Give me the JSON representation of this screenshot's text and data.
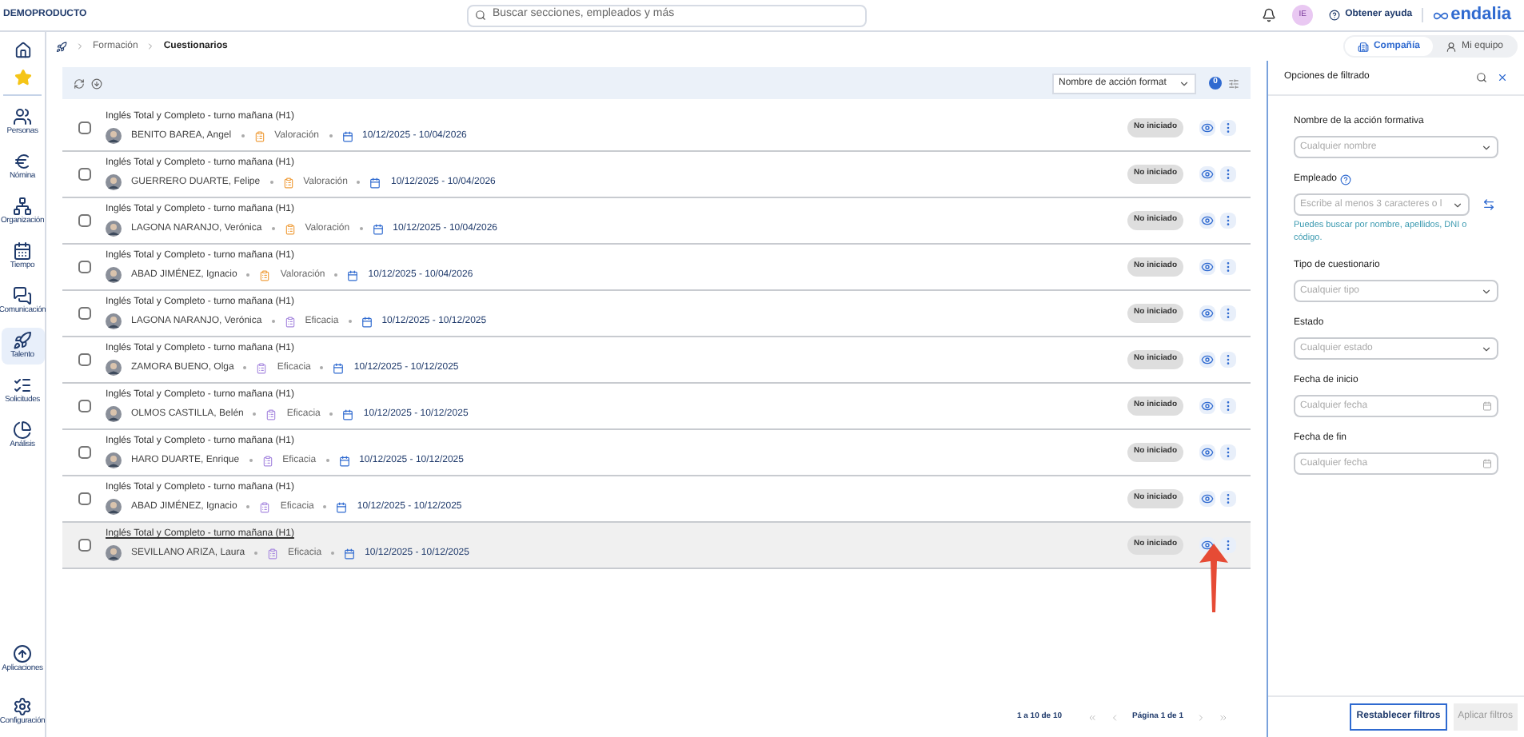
{
  "topbar": {
    "brand": "DEMOPRODUCTO",
    "search": {
      "placeholder": "Buscar secciones, empleados y más"
    },
    "avatar": "IE",
    "help": "Obtener ayuda",
    "logo": "endalia"
  },
  "sidebar": {
    "items": [
      {
        "label": "Personas",
        "selected": false
      },
      {
        "label": "Nómina",
        "selected": false
      },
      {
        "label": "Organización",
        "selected": false
      },
      {
        "label": "Tiempo",
        "selected": false
      },
      {
        "label": "Comunicación",
        "selected": false
      },
      {
        "label": "Talento",
        "selected": true
      },
      {
        "label": "Solicitudes",
        "selected": false
      },
      {
        "label": "Análisis",
        "selected": false
      }
    ],
    "bottom": [
      {
        "label": "Aplicaciones"
      },
      {
        "label": "Configuración"
      }
    ]
  },
  "breadcrumb": [
    "Formación",
    "Cuestionarios"
  ],
  "scope_tabs": [
    {
      "label": "Compañía",
      "selected": true
    },
    {
      "label": "Mi equipo",
      "selected": false
    }
  ],
  "toolbar": {
    "sort": "Nombre de acción format",
    "filter_count": "0"
  },
  "rows": [
    {
      "title": "Inglés Total y Completo - turno mañana (H1)",
      "employee": "BENITO BAREA, Angel",
      "kind": "valoracion",
      "type": "Valoración",
      "dates": "10/12/2025 - 10/04/2026",
      "status": "No iniciado",
      "hovered": false
    },
    {
      "title": "Inglés Total y Completo - turno mañana (H1)",
      "employee": "GUERRERO DUARTE, Felipe",
      "kind": "valoracion",
      "type": "Valoración",
      "dates": "10/12/2025 - 10/04/2026",
      "status": "No iniciado",
      "hovered": false
    },
    {
      "title": "Inglés Total y Completo - turno mañana (H1)",
      "employee": "LAGONA NARANJO, Verónica",
      "kind": "valoracion",
      "type": "Valoración",
      "dates": "10/12/2025 - 10/04/2026",
      "status": "No iniciado",
      "hovered": false
    },
    {
      "title": "Inglés Total y Completo - turno mañana (H1)",
      "employee": "ABAD JIMÉNEZ, Ignacio",
      "kind": "valoracion",
      "type": "Valoración",
      "dates": "10/12/2025 - 10/04/2026",
      "status": "No iniciado",
      "hovered": false
    },
    {
      "title": "Inglés Total y Completo - turno mañana (H1)",
      "employee": "LAGONA NARANJO, Verónica",
      "kind": "eficacia",
      "type": "Eficacia",
      "dates": "10/12/2025 - 10/12/2025",
      "status": "No iniciado",
      "hovered": false
    },
    {
      "title": "Inglés Total y Completo - turno mañana (H1)",
      "employee": "ZAMORA BUENO, Olga",
      "kind": "eficacia",
      "type": "Eficacia",
      "dates": "10/12/2025 - 10/12/2025",
      "status": "No iniciado",
      "hovered": false
    },
    {
      "title": "Inglés Total y Completo - turno mañana (H1)",
      "employee": "OLMOS CASTILLA, Belén",
      "kind": "eficacia",
      "type": "Eficacia",
      "dates": "10/12/2025 - 10/12/2025",
      "status": "No iniciado",
      "hovered": false
    },
    {
      "title": "Inglés Total y Completo - turno mañana (H1)",
      "employee": "HARO DUARTE, Enrique",
      "kind": "eficacia",
      "type": "Eficacia",
      "dates": "10/12/2025 - 10/12/2025",
      "status": "No iniciado",
      "hovered": false
    },
    {
      "title": "Inglés Total y Completo - turno mañana (H1)",
      "employee": "ABAD JIMÉNEZ, Ignacio",
      "kind": "eficacia",
      "type": "Eficacia",
      "dates": "10/12/2025 - 10/12/2025",
      "status": "No iniciado",
      "hovered": false
    },
    {
      "title": "Inglés Total y Completo - turno mañana (H1)",
      "employee": "SEVILLANO ARIZA, Laura",
      "kind": "eficacia",
      "type": "Eficacia",
      "dates": "10/12/2025 - 10/12/2025",
      "status": "No iniciado",
      "hovered": true
    }
  ],
  "pagination": {
    "range": "1 a 10 de 10",
    "page": "Página 1 de 1"
  },
  "filters": {
    "title": "Opciones de filtrado",
    "fields": [
      {
        "kind": "select",
        "label": "Nombre de la acción formativa",
        "placeholder": "Cualquier nombre"
      },
      {
        "kind": "employee",
        "label": "Empleado",
        "placeholder": "Escribe al menos 3 caracteres o l",
        "hint": "Puedes buscar por nombre, apellidos, DNI o código."
      },
      {
        "kind": "select",
        "label": "Tipo de cuestionario",
        "placeholder": "Cualquier tipo"
      },
      {
        "kind": "select",
        "label": "Estado",
        "placeholder": "Cualquier estado"
      },
      {
        "kind": "date",
        "label": "Fecha de inicio",
        "placeholder": "Cualquier fecha"
      },
      {
        "kind": "date",
        "label": "Fecha de fin",
        "placeholder": "Cualquier fecha"
      }
    ],
    "reset": "Restablecer filtros",
    "apply": "Aplicar filtros"
  }
}
